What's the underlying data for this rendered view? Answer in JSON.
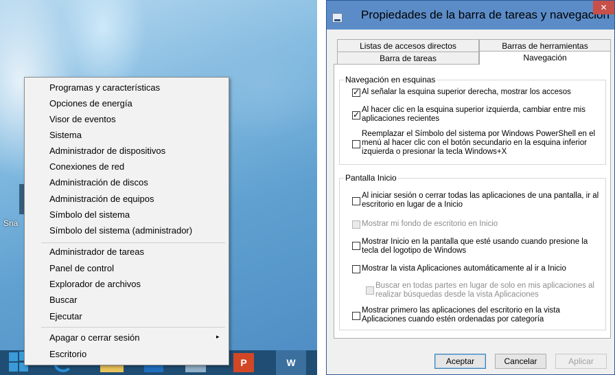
{
  "desktop": {
    "shortcut_label": "Sna"
  },
  "winx_menu": {
    "items": [
      "Programas y características",
      "Opciones de energía",
      "Visor de eventos",
      "Sistema",
      "Administrador de dispositivos",
      "Conexiones de red",
      "Administración de discos",
      "Administración de equipos",
      "Símbolo del sistema",
      "Símbolo del sistema (administrador)",
      "Administrador de tareas",
      "Panel de control",
      "Explorador de archivos",
      "Buscar",
      "Ejecutar",
      "Apagar o cerrar sesión",
      "Escritorio"
    ],
    "submenu_arrow": "▸"
  },
  "taskbar": {
    "ppt_label": "P",
    "word_label": "W",
    "icons": [
      "windows-start-icon",
      "internet-explorer-icon",
      "file-explorer-icon",
      "outlook-icon",
      "app-icon",
      "powerpoint-icon",
      "word-icon"
    ]
  },
  "dialog": {
    "title": "Propiedades de la barra de tareas y navegación",
    "close_label": "✕",
    "tabs": {
      "listas": "Listas de accesos directos",
      "herramientas": "Barras de herramientas",
      "barra": "Barra de tareas",
      "navegacion": "Navegación"
    },
    "active_tab": "Navegación",
    "group_esquinas": {
      "title": "Navegación en esquinas",
      "options": [
        {
          "text": "Al señalar la esquina superior derecha, mostrar los accesos",
          "checked": true
        },
        {
          "text": "Al hacer clic en la esquina superior izquierda, cambiar entre mis aplicaciones recientes",
          "checked": true
        },
        {
          "text": "Reemplazar el Símbolo del sistema por Windows PowerShell en el menú al hacer clic con el botón secundario en la esquina inferior izquierda o presionar la tecla Windows+X",
          "checked": false
        }
      ]
    },
    "group_inicio": {
      "title": "Pantalla Inicio",
      "options": [
        {
          "text": "Al iniciar sesión o cerrar todas las aplicaciones de una pantalla, ir al escritorio en lugar de a Inicio",
          "checked": false,
          "disabled": false
        },
        {
          "text": "Mostrar mi fondo de escritorio en Inicio",
          "checked": false,
          "disabled": true
        },
        {
          "text": "Mostrar Inicio en la pantalla que esté usando cuando presione la tecla del logotipo de Windows",
          "checked": false,
          "disabled": false
        },
        {
          "text": "Mostrar la vista Aplicaciones automáticamente al ir a Inicio",
          "checked": false,
          "disabled": false
        },
        {
          "text": "Buscar en todas partes en lugar de solo en mis aplicaciones al realizar búsquedas desde la vista Aplicaciones",
          "checked": false,
          "disabled": true
        },
        {
          "text": "Mostrar primero las aplicaciones del escritorio en la vista Aplicaciones cuando estén ordenadas por categoría",
          "checked": false,
          "disabled": false
        }
      ]
    },
    "buttons": {
      "ok": "Aceptar",
      "cancel": "Cancelar",
      "apply": "Aplicar"
    }
  },
  "colors": {
    "titlebar": "#5b8cc8",
    "close": "#c7504a",
    "taskbar": "#1f4d73"
  }
}
